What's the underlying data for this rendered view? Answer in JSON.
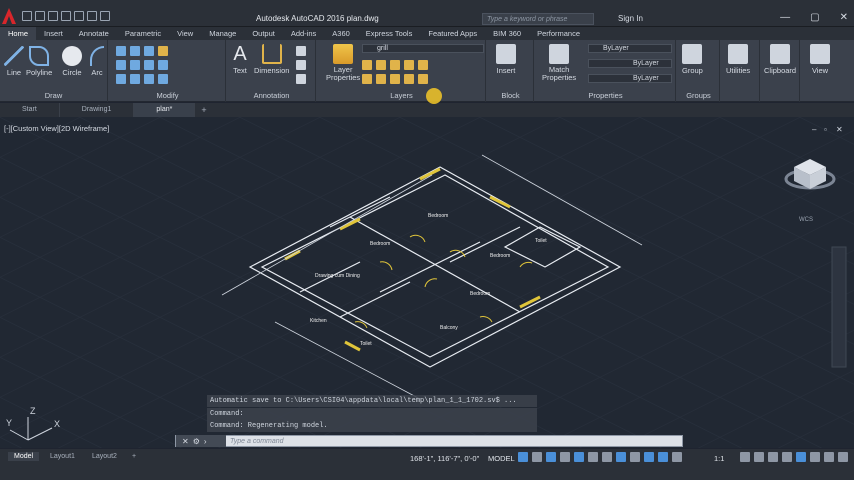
{
  "window": {
    "title": "Autodesk AutoCAD 2016    plan.dwg",
    "search_placeholder": "Type a keyword or phrase",
    "signin": "Sign In"
  },
  "menu_tabs": [
    "Home",
    "Insert",
    "Annotate",
    "Parametric",
    "View",
    "Manage",
    "Output",
    "Add-ins",
    "A360",
    "Express Tools",
    "Featured Apps",
    "BIM 360",
    "Performance"
  ],
  "ribbon": {
    "draw": {
      "title": "Draw",
      "tools": [
        "Line",
        "Polyline",
        "Circle",
        "Arc"
      ]
    },
    "modify": {
      "title": "Modify"
    },
    "annotation": {
      "title": "Annotation",
      "tools": [
        "Text",
        "Dimension"
      ]
    },
    "layers": {
      "title": "Layers",
      "properties_label": "Layer\nProperties",
      "layer_name": "grill"
    },
    "block": {
      "title": "Block",
      "insert": "Insert"
    },
    "properties": {
      "title": "Properties",
      "match": "Match\nProperties",
      "bylayer1": "ByLayer",
      "bylayer2": "ByLayer",
      "bylayer3": "ByLayer"
    },
    "groups": {
      "title": "Groups",
      "group": "Group"
    },
    "utilities": "Utilities",
    "clipboard": "Clipboard",
    "view": "View"
  },
  "file_tabs": [
    "Start",
    "Drawing1",
    "plan*"
  ],
  "viewport": {
    "label": "[-][Custom View][2D Wireframe]",
    "wcs": "WCS"
  },
  "command_history": [
    "Automatic save to C:\\Users\\CSI04\\appdata\\local\\temp\\plan_1_1_1702.sv$ ...",
    "Command:",
    "Command:  Regenerating model."
  ],
  "command_placeholder": "Type a command",
  "layout_tabs": [
    "Model",
    "Layout1",
    "Layout2"
  ],
  "status": {
    "coords": "168'-1\", 116'-7\", 0'-0\"",
    "model": "MODEL",
    "scale": "1:1"
  },
  "room_labels": [
    "Bedroom",
    "Bedroom",
    "Kitchen",
    "Bedroom",
    "Bedroom",
    "Toilet",
    "Drawing cum Dining",
    "Balcony",
    "Toilet"
  ],
  "axis": {
    "x": "X",
    "y": "Y",
    "z": "Z"
  }
}
